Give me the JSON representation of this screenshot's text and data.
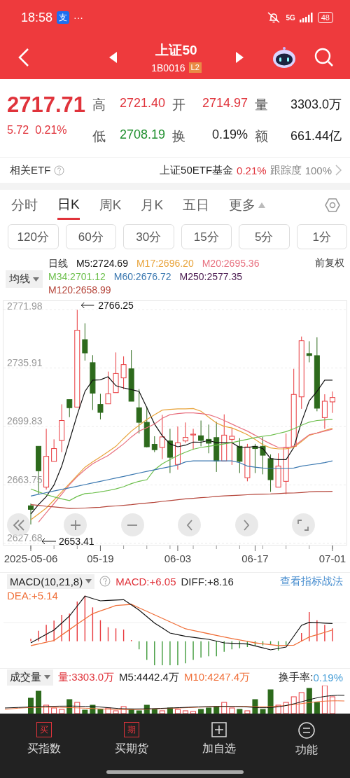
{
  "status_bar": {
    "time": "18:58",
    "app_icon": "支",
    "overflow": "···",
    "network": "5G",
    "battery": "48"
  },
  "nav": {
    "title": "上证50",
    "code": "1B0016",
    "badge": "L2"
  },
  "quote": {
    "price": "2717.71",
    "change": "5.72",
    "change_pct": "0.21%",
    "stats": [
      {
        "label": "高",
        "value": "2721.40",
        "color": "#e0333b"
      },
      {
        "label": "开",
        "value": "2714.97",
        "color": "#e0333b"
      },
      {
        "label": "量",
        "value": "3303.0万",
        "color": "#222222"
      },
      {
        "label": "低",
        "value": "2708.19",
        "color": "#1f8f2e"
      },
      {
        "label": "换",
        "value": "0.19%",
        "color": "#222222"
      },
      {
        "label": "额",
        "value": "661.44亿",
        "color": "#222222"
      }
    ]
  },
  "etf_row": {
    "label": "相关ETF",
    "fund": "上证50ETF基金",
    "fund_change": "0.21%",
    "tracking_label": "跟踪度",
    "tracking_value": "100%"
  },
  "tabs": [
    {
      "label": "分时",
      "selected": false
    },
    {
      "label": "日K",
      "selected": true
    },
    {
      "label": "周K",
      "selected": false
    },
    {
      "label": "月K",
      "selected": false
    },
    {
      "label": "五日",
      "selected": false
    },
    {
      "label": "更多",
      "selected": false
    }
  ],
  "periods": [
    {
      "label": "120分",
      "selected": false
    },
    {
      "label": "60分",
      "selected": false
    },
    {
      "label": "30分",
      "selected": false
    },
    {
      "label": "15分",
      "selected": false
    },
    {
      "label": "5分",
      "selected": false
    },
    {
      "label": "1分",
      "selected": false
    }
  ],
  "ma_legend": {
    "dropdown": "均线",
    "title": "日线",
    "adjust": "前复权",
    "items": [
      {
        "label": "M5:2724.69",
        "color": "#111111"
      },
      {
        "label": "M17:2696.20",
        "color": "#e8a33a"
      },
      {
        "label": "M20:2695.36",
        "color": "#e8707f"
      },
      {
        "label": "M34:2701.12",
        "color": "#6cbf4b"
      },
      {
        "label": "M60:2676.72",
        "color": "#3b78b0"
      },
      {
        "label": "M250:2577.35",
        "color": "#4a1a50"
      },
      {
        "label": "M120:2658.99",
        "color": "#b5453a"
      }
    ]
  },
  "kline": {
    "chart_data": {
      "type": "candlestick",
      "categories": [
        "2025-05-06",
        null,
        null,
        null,
        null,
        null,
        null,
        null,
        null,
        "05-19",
        null,
        null,
        null,
        null,
        null,
        null,
        null,
        null,
        null,
        "06-03",
        null,
        null,
        null,
        null,
        null,
        null,
        null,
        null,
        null,
        "06-17",
        null,
        null,
        null,
        null,
        null,
        null,
        null,
        null,
        null,
        "07-01"
      ],
      "ylim": [
        2626.4,
        2777.6
      ],
      "yticks": [
        2771.98,
        2735.91,
        2699.83,
        2663.75,
        2627.68
      ],
      "ohlc": [
        [
          2650.9,
          2652.3,
          2639.4,
          2648.7
        ],
        [
          2687.6,
          2687.6,
          2658.1,
          2672.5
        ],
        [
          2662.4,
          2698.4,
          2660.9,
          2681.4
        ],
        [
          2678.3,
          2691.9,
          2678.3,
          2686.2
        ],
        [
          2691.2,
          2713.5,
          2684.0,
          2703.5
        ],
        [
          2716.4,
          2716.4,
          2705.6,
          2711.4
        ],
        [
          2711.8,
          2771.8,
          2711.8,
          2759.2
        ],
        [
          2753.4,
          2763.5,
          2740.5,
          2745.2
        ],
        [
          2739.2,
          2743.8,
          2710.0,
          2720.4
        ],
        [
          2713.4,
          2720.0,
          2704.2,
          2708.5
        ],
        [
          2713.8,
          2733.7,
          2713.8,
          2720.0
        ],
        [
          2720.7,
          2745.5,
          2720.7,
          2732.5
        ],
        [
          2729.8,
          2743.1,
          2722.9,
          2738.0
        ],
        [
          2735.4,
          2746.9,
          2715.4,
          2715.4
        ],
        [
          2711.4,
          2722.9,
          2695.5,
          2702.4
        ],
        [
          2702.4,
          2712.1,
          2686.9,
          2687.3
        ],
        [
          2688.8,
          2693.8,
          2684.0,
          2685.5
        ],
        [
          2686.9,
          2707.0,
          2679.7,
          2693.4
        ],
        [
          2690.9,
          2698.4,
          2671.1,
          2680.8
        ],
        [
          2676.4,
          2699.8,
          2673.2,
          2689.8
        ],
        [
          2690.9,
          2702.3,
          2689.8,
          2693.1
        ],
        [
          2694.6,
          2698.4,
          2685.5,
          2695.1
        ],
        [
          2694.1,
          2703.5,
          2687.6,
          2691.2
        ],
        [
          2691.9,
          2701.0,
          2683.3,
          2689.5
        ],
        [
          2693.0,
          2702.7,
          2671.8,
          2678.5
        ],
        [
          2678.5,
          2707.3,
          2678.5,
          2694.5
        ],
        [
          2691.9,
          2699.1,
          2676.1,
          2693.8
        ],
        [
          2687.6,
          2692.6,
          2671.1,
          2678.3
        ],
        [
          2668.2,
          2689.1,
          2666.0,
          2687.2
        ],
        [
          2687.6,
          2689.1,
          2671.1,
          2686.2
        ],
        [
          2687.6,
          2693.4,
          2670.3,
          2682.1
        ],
        [
          2680.0,
          2682.6,
          2659.5,
          2667.0
        ],
        [
          2662.4,
          2683.3,
          2662.4,
          2675.4
        ],
        [
          2666.0,
          2695.5,
          2658.1,
          2686.9
        ],
        [
          2687.6,
          2735.4,
          2687.6,
          2719.6
        ],
        [
          2718.1,
          2755.3,
          2710.7,
          2752.7
        ],
        [
          2744.8,
          2752.4,
          2739.4,
          2743.6
        ],
        [
          2743.5,
          2754.9,
          2709.2,
          2711.1
        ],
        [
          2705.3,
          2719.7,
          2698.4,
          2715.4
        ],
        [
          2715.0,
          2721.4,
          2708.2,
          2717.7
        ]
      ],
      "series": [
        {
          "type": "line",
          "color": "#111111",
          "values": [
            2645.8,
            2651.6,
            2656.6,
            2663.8,
            2675.4,
            2691.2,
            2707.0,
            2721.5,
            2728.4,
            2728.6,
            2730.5,
            2725.0,
            2723.6,
            2722.6,
            2721.5,
            2711.4,
            2701.3,
            2694.1,
            2689.1,
            2687.3,
            2688.3,
            2690.2,
            2690.1,
            2691.2,
            2689.8,
            2689.8,
            2689.8,
            2686.9,
            2686.9,
            2687.6,
            2686.2,
            2680.0,
            2679.4,
            2679.4,
            2686.9,
            2702.7,
            2715.7,
            2721.5,
            2728.4,
            2728.4
          ]
        },
        {
          "type": "line",
          "color": "#e8a33a",
          "values": [
            2642.3,
            2645.9,
            2649.5,
            2654.5,
            2659.5,
            2664.6,
            2669.6,
            2674.7,
            2678.0,
            2681.1,
            2684.3,
            2687.6,
            2692.4,
            2697.0,
            2700.6,
            2704.2,
            2707.1,
            2709.9,
            2710.4,
            2710.7,
            2710.7,
            2710.9,
            2709.2,
            2705.6,
            2702.0,
            2699.9,
            2698.9,
            2697.0,
            2694.8,
            2691.9,
            2688.6,
            2686.6,
            2686.0,
            2686.1,
            2686.9,
            2690.5,
            2694.4,
            2695.8,
            2697.3,
            2698.7
          ]
        },
        {
          "type": "line",
          "color": "#e8707f",
          "values": [
            null,
            2640.8,
            2646.6,
            2652.3,
            2658.1,
            2663.9,
            2668.9,
            2673.2,
            2676.8,
            2679.4,
            2681.9,
            2685.5,
            2689.1,
            2693.4,
            2697.0,
            2699.1,
            2701.3,
            2704.9,
            2707.1,
            2707.8,
            2708.2,
            2708.2,
            2707.8,
            2707.1,
            2705.6,
            2703.5,
            2701.3,
            2699.1,
            2697.0,
            2694.4,
            2691.5,
            2689.1,
            2686.9,
            2686.6,
            2687.6,
            2691.2,
            2694.8,
            2695.8,
            2697.0,
            2698.1
          ]
        },
        {
          "type": "line",
          "color": "#6cbf4b",
          "values": [
            2661.3,
            2659.5,
            2657.8,
            2656.4,
            2655.2,
            2654.1,
            2656.7,
            2658.4,
            2658.8,
            2659.5,
            2660.3,
            2661.3,
            2662.7,
            2664.6,
            2666.0,
            2667.0,
            2673.2,
            2676.8,
            2679.4,
            2681.9,
            2684.0,
            2685.8,
            2686.9,
            2687.6,
            2688.3,
            2689.1,
            2689.8,
            2690.9,
            2691.9,
            2693.0,
            2693.8,
            2694.4,
            2695.5,
            2696.7,
            2698.4,
            2700.6,
            2702.5,
            2703.5,
            2703.9,
            2704.2
          ]
        },
        {
          "type": "line",
          "color": "#3b78b0",
          "values": [
            2656.9,
            2658.0,
            2659.0,
            2660.0,
            2661.0,
            2662.0,
            2663.0,
            2664.0,
            2665.0,
            2666.0,
            2667.0,
            2668.0,
            2669.0,
            2670.1,
            2671.1,
            2672.1,
            2673.1,
            2674.1,
            2675.1,
            2676.1,
            2678.0,
            2678.6,
            2678.6,
            2678.6,
            2678.6,
            2678.6,
            2678.6,
            2677.5,
            2675.4,
            2674.7,
            2674.2,
            2673.9,
            2673.9,
            2673.9,
            2674.2,
            2675.4,
            2676.1,
            2676.8,
            2677.5,
            2678.6
          ]
        },
        {
          "type": "line",
          "color": "#b5453a",
          "values": [
            2651.6,
            2651.2,
            2650.6,
            2650.2,
            2649.8,
            2649.2,
            2649.3,
            2649.5,
            2649.8,
            2650.0,
            2650.5,
            2650.8,
            2651.2,
            2651.6,
            2652.2,
            2652.6,
            2653.0,
            2653.6,
            2654.1,
            2654.6,
            2655.2,
            2655.5,
            2655.9,
            2656.2,
            2656.7,
            2657.0,
            2657.2,
            2657.4,
            2657.7,
            2658.0,
            2658.1,
            2658.2,
            2658.4,
            2658.7,
            2658.8,
            2659.1,
            2659.5,
            2659.7,
            2659.7,
            2659.8
          ]
        }
      ],
      "grid": true,
      "annotations": [
        "2766.25",
        "2653.41"
      ]
    }
  },
  "macd": {
    "dropdown": "MACD(10,21,8)",
    "macd": "MACD:+6.05",
    "diff": "DIFF:+8.16",
    "link": "查看指标战法",
    "dea": "DEA:+5.14"
  },
  "volume": {
    "dropdown": "成交量",
    "vol": "量:3303.0万",
    "m5": "M5:4442.4万",
    "m10": "M10:4247.4万",
    "turnover_label": "换手率:",
    "turnover_value": "0.19%"
  },
  "bottom_bar": [
    {
      "kind": "badge",
      "icon": "买",
      "label": "买指数"
    },
    {
      "kind": "badge",
      "icon": "期",
      "label": "买期货"
    },
    {
      "kind": "plus",
      "label": "加自选"
    },
    {
      "kind": "menu",
      "label": "功能"
    }
  ]
}
